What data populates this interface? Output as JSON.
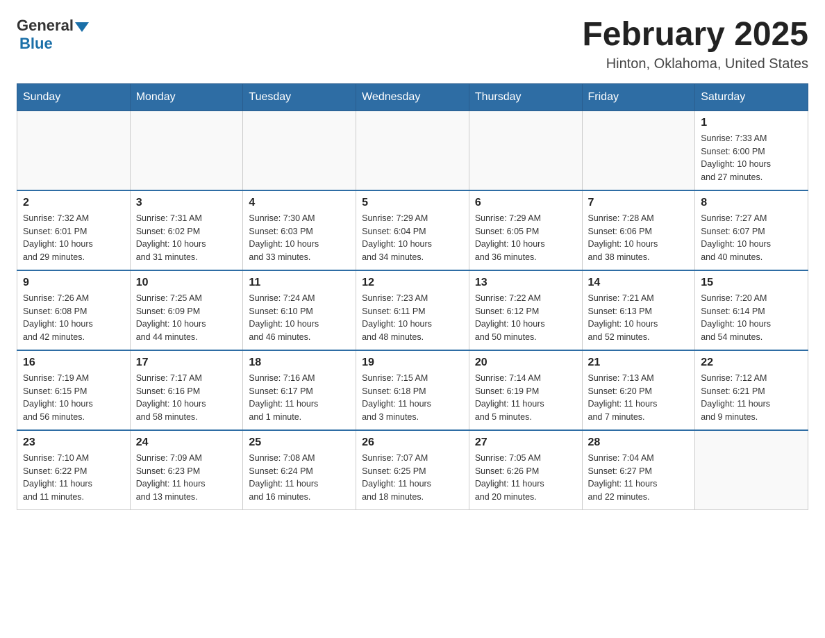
{
  "header": {
    "logo_general": "General",
    "logo_blue": "Blue",
    "month_title": "February 2025",
    "location": "Hinton, Oklahoma, United States"
  },
  "weekdays": [
    "Sunday",
    "Monday",
    "Tuesday",
    "Wednesday",
    "Thursday",
    "Friday",
    "Saturday"
  ],
  "weeks": [
    [
      {
        "day": "",
        "info": ""
      },
      {
        "day": "",
        "info": ""
      },
      {
        "day": "",
        "info": ""
      },
      {
        "day": "",
        "info": ""
      },
      {
        "day": "",
        "info": ""
      },
      {
        "day": "",
        "info": ""
      },
      {
        "day": "1",
        "info": "Sunrise: 7:33 AM\nSunset: 6:00 PM\nDaylight: 10 hours\nand 27 minutes."
      }
    ],
    [
      {
        "day": "2",
        "info": "Sunrise: 7:32 AM\nSunset: 6:01 PM\nDaylight: 10 hours\nand 29 minutes."
      },
      {
        "day": "3",
        "info": "Sunrise: 7:31 AM\nSunset: 6:02 PM\nDaylight: 10 hours\nand 31 minutes."
      },
      {
        "day": "4",
        "info": "Sunrise: 7:30 AM\nSunset: 6:03 PM\nDaylight: 10 hours\nand 33 minutes."
      },
      {
        "day": "5",
        "info": "Sunrise: 7:29 AM\nSunset: 6:04 PM\nDaylight: 10 hours\nand 34 minutes."
      },
      {
        "day": "6",
        "info": "Sunrise: 7:29 AM\nSunset: 6:05 PM\nDaylight: 10 hours\nand 36 minutes."
      },
      {
        "day": "7",
        "info": "Sunrise: 7:28 AM\nSunset: 6:06 PM\nDaylight: 10 hours\nand 38 minutes."
      },
      {
        "day": "8",
        "info": "Sunrise: 7:27 AM\nSunset: 6:07 PM\nDaylight: 10 hours\nand 40 minutes."
      }
    ],
    [
      {
        "day": "9",
        "info": "Sunrise: 7:26 AM\nSunset: 6:08 PM\nDaylight: 10 hours\nand 42 minutes."
      },
      {
        "day": "10",
        "info": "Sunrise: 7:25 AM\nSunset: 6:09 PM\nDaylight: 10 hours\nand 44 minutes."
      },
      {
        "day": "11",
        "info": "Sunrise: 7:24 AM\nSunset: 6:10 PM\nDaylight: 10 hours\nand 46 minutes."
      },
      {
        "day": "12",
        "info": "Sunrise: 7:23 AM\nSunset: 6:11 PM\nDaylight: 10 hours\nand 48 minutes."
      },
      {
        "day": "13",
        "info": "Sunrise: 7:22 AM\nSunset: 6:12 PM\nDaylight: 10 hours\nand 50 minutes."
      },
      {
        "day": "14",
        "info": "Sunrise: 7:21 AM\nSunset: 6:13 PM\nDaylight: 10 hours\nand 52 minutes."
      },
      {
        "day": "15",
        "info": "Sunrise: 7:20 AM\nSunset: 6:14 PM\nDaylight: 10 hours\nand 54 minutes."
      }
    ],
    [
      {
        "day": "16",
        "info": "Sunrise: 7:19 AM\nSunset: 6:15 PM\nDaylight: 10 hours\nand 56 minutes."
      },
      {
        "day": "17",
        "info": "Sunrise: 7:17 AM\nSunset: 6:16 PM\nDaylight: 10 hours\nand 58 minutes."
      },
      {
        "day": "18",
        "info": "Sunrise: 7:16 AM\nSunset: 6:17 PM\nDaylight: 11 hours\nand 1 minute."
      },
      {
        "day": "19",
        "info": "Sunrise: 7:15 AM\nSunset: 6:18 PM\nDaylight: 11 hours\nand 3 minutes."
      },
      {
        "day": "20",
        "info": "Sunrise: 7:14 AM\nSunset: 6:19 PM\nDaylight: 11 hours\nand 5 minutes."
      },
      {
        "day": "21",
        "info": "Sunrise: 7:13 AM\nSunset: 6:20 PM\nDaylight: 11 hours\nand 7 minutes."
      },
      {
        "day": "22",
        "info": "Sunrise: 7:12 AM\nSunset: 6:21 PM\nDaylight: 11 hours\nand 9 minutes."
      }
    ],
    [
      {
        "day": "23",
        "info": "Sunrise: 7:10 AM\nSunset: 6:22 PM\nDaylight: 11 hours\nand 11 minutes."
      },
      {
        "day": "24",
        "info": "Sunrise: 7:09 AM\nSunset: 6:23 PM\nDaylight: 11 hours\nand 13 minutes."
      },
      {
        "day": "25",
        "info": "Sunrise: 7:08 AM\nSunset: 6:24 PM\nDaylight: 11 hours\nand 16 minutes."
      },
      {
        "day": "26",
        "info": "Sunrise: 7:07 AM\nSunset: 6:25 PM\nDaylight: 11 hours\nand 18 minutes."
      },
      {
        "day": "27",
        "info": "Sunrise: 7:05 AM\nSunset: 6:26 PM\nDaylight: 11 hours\nand 20 minutes."
      },
      {
        "day": "28",
        "info": "Sunrise: 7:04 AM\nSunset: 6:27 PM\nDaylight: 11 hours\nand 22 minutes."
      },
      {
        "day": "",
        "info": ""
      }
    ]
  ]
}
